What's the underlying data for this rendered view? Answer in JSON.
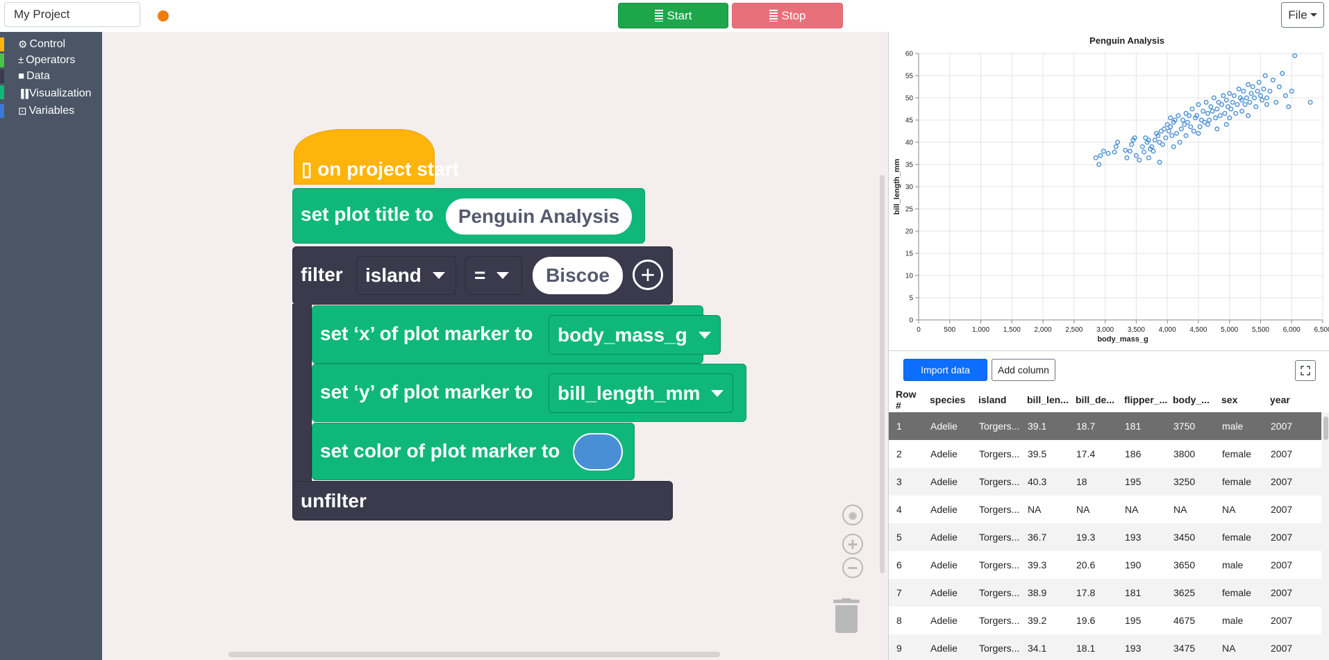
{
  "topbar": {
    "project_name": "My Project",
    "status_color": "#f07c0c",
    "start_label": "Start",
    "stop_label": "Stop",
    "file_label": "File",
    "start_icon": "stack-icon",
    "stop_icon": "stack-icon"
  },
  "toolbox": {
    "categories": [
      {
        "label": "Control",
        "icon": "⚙",
        "color": "#ffb40a"
      },
      {
        "label": "Operators",
        "icon": "±",
        "color": "#4cc24a"
      },
      {
        "label": "Data",
        "icon": "■",
        "color": "#3a3a4c"
      },
      {
        "label": "Visualization",
        "icon": "▐▐",
        "color": "#0fb87a"
      },
      {
        "label": "Variables",
        "icon": "⊡",
        "color": "#3c78d8"
      }
    ]
  },
  "workspace": {
    "hat_block": {
      "icon": "▯",
      "label": "on project start"
    },
    "set_title": {
      "label": "set plot title to",
      "value": "Penguin Analysis"
    },
    "filter": {
      "label": "filter",
      "column": "island",
      "operator": "=",
      "value": "Biscoe"
    },
    "set_x": {
      "label": "set ‘x’ of plot marker to",
      "value": "body_mass_g"
    },
    "set_y": {
      "label": "set ‘y’ of plot marker to",
      "value": "bill_length_mm"
    },
    "set_color": {
      "label": "set color of plot marker to",
      "color": "#4a8fd6"
    },
    "unfilter": {
      "label": "unfilter"
    }
  },
  "data_panel": {
    "import_label": "Import data",
    "add_column_label": "Add column",
    "columns": [
      "Row #",
      "species",
      "island",
      "bill_len...",
      "bill_de...",
      "flipper_...",
      "body_...",
      "sex",
      "year"
    ],
    "rows": [
      [
        "1",
        "Adelie",
        "Torgers...",
        "39.1",
        "18.7",
        "181",
        "3750",
        "male",
        "2007"
      ],
      [
        "2",
        "Adelie",
        "Torgers...",
        "39.5",
        "17.4",
        "186",
        "3800",
        "female",
        "2007"
      ],
      [
        "3",
        "Adelie",
        "Torgers...",
        "40.3",
        "18",
        "195",
        "3250",
        "female",
        "2007"
      ],
      [
        "4",
        "Adelie",
        "Torgers...",
        "NA",
        "NA",
        "NA",
        "NA",
        "NA",
        "2007"
      ],
      [
        "5",
        "Adelie",
        "Torgers...",
        "36.7",
        "19.3",
        "193",
        "3450",
        "female",
        "2007"
      ],
      [
        "6",
        "Adelie",
        "Torgers...",
        "39.3",
        "20.6",
        "190",
        "3650",
        "male",
        "2007"
      ],
      [
        "7",
        "Adelie",
        "Torgers...",
        "38.9",
        "17.8",
        "181",
        "3625",
        "female",
        "2007"
      ],
      [
        "8",
        "Adelie",
        "Torgers...",
        "39.2",
        "19.6",
        "195",
        "4675",
        "male",
        "2007"
      ],
      [
        "9",
        "Adelie",
        "Torgers...",
        "34.1",
        "18.1",
        "193",
        "3475",
        "NA",
        "2007"
      ]
    ],
    "selected_row": 0
  },
  "chart_data": {
    "type": "scatter",
    "title": "Penguin Analysis",
    "xlabel": "body_mass_g",
    "ylabel": "bill_length_mm",
    "xlim": [
      0,
      6500
    ],
    "ylim": [
      0,
      60
    ],
    "xticks": [
      0,
      500,
      1000,
      1500,
      2000,
      2500,
      3000,
      3500,
      4000,
      4500,
      5000,
      5500,
      6000,
      6500
    ],
    "xtick_labels": [
      "0",
      "500",
      "1,000",
      "1,500",
      "2,000",
      "2,500",
      "3,000",
      "3,500",
      "4,000",
      "4,500",
      "5,000",
      "5,500",
      "6,000",
      "6,500"
    ],
    "yticks": [
      0,
      5,
      10,
      15,
      20,
      25,
      30,
      35,
      40,
      45,
      50,
      55,
      60
    ],
    "grid": true,
    "marker_color": "#4a8fd6",
    "points": [
      [
        2850,
        36.5
      ],
      [
        2900,
        35.0
      ],
      [
        2925,
        37.0
      ],
      [
        2975,
        38.0
      ],
      [
        3050,
        37.5
      ],
      [
        3150,
        37.8
      ],
      [
        3175,
        39.0
      ],
      [
        3200,
        40.0
      ],
      [
        3325,
        38.2
      ],
      [
        3400,
        38.0
      ],
      [
        3425,
        39.5
      ],
      [
        3450,
        40.5
      ],
      [
        3475,
        41.0
      ],
      [
        3500,
        37.0
      ],
      [
        3550,
        36.0
      ],
      [
        3600,
        39.0
      ],
      [
        3625,
        37.8
      ],
      [
        3650,
        41.0
      ],
      [
        3675,
        40.0
      ],
      [
        3700,
        36.5
      ],
      [
        3725,
        38.5
      ],
      [
        3750,
        39.0
      ],
      [
        3775,
        38.0
      ],
      [
        3800,
        40.5
      ],
      [
        3825,
        42.0
      ],
      [
        3850,
        41.5
      ],
      [
        3875,
        40.0
      ],
      [
        3900,
        42.5
      ],
      [
        3925,
        39.5
      ],
      [
        3950,
        43.0
      ],
      [
        3975,
        41.0
      ],
      [
        4000,
        44.0
      ],
      [
        4025,
        42.5
      ],
      [
        4050,
        43.5
      ],
      [
        4075,
        41.5
      ],
      [
        4100,
        44.5
      ],
      [
        4125,
        45.0
      ],
      [
        4150,
        42.0
      ],
      [
        4175,
        46.0
      ],
      [
        4200,
        40.0
      ],
      [
        4225,
        43.0
      ],
      [
        4250,
        45.0
      ],
      [
        4275,
        44.0
      ],
      [
        4300,
        46.5
      ],
      [
        4325,
        44.5
      ],
      [
        4350,
        46.0
      ],
      [
        4375,
        43.5
      ],
      [
        4400,
        47.5
      ],
      [
        4425,
        42.5
      ],
      [
        4450,
        45.5
      ],
      [
        4475,
        46.0
      ],
      [
        4500,
        48.5
      ],
      [
        4525,
        43.5
      ],
      [
        4550,
        45.0
      ],
      [
        4575,
        47.0
      ],
      [
        4600,
        44.5
      ],
      [
        4625,
        49.0
      ],
      [
        4650,
        46.5
      ],
      [
        4675,
        45.0
      ],
      [
        4700,
        48.0
      ],
      [
        4725,
        47.0
      ],
      [
        4750,
        50.0
      ],
      [
        4775,
        45.5
      ],
      [
        4800,
        47.5
      ],
      [
        4825,
        49.0
      ],
      [
        4850,
        46.0
      ],
      [
        4875,
        48.5
      ],
      [
        4900,
        50.5
      ],
      [
        4925,
        46.5
      ],
      [
        4950,
        49.5
      ],
      [
        4975,
        48.0
      ],
      [
        5000,
        51.0
      ],
      [
        5025,
        47.5
      ],
      [
        5050,
        49.0
      ],
      [
        5075,
        50.5
      ],
      [
        5100,
        46.5
      ],
      [
        5125,
        48.5
      ],
      [
        5150,
        52.0
      ],
      [
        5175,
        50.0
      ],
      [
        5200,
        49.5
      ],
      [
        5225,
        51.5
      ],
      [
        5250,
        48.5
      ],
      [
        5275,
        50.0
      ],
      [
        5300,
        53.0
      ],
      [
        5325,
        49.0
      ],
      [
        5350,
        51.0
      ],
      [
        5375,
        52.5
      ],
      [
        5400,
        50.0
      ],
      [
        5425,
        48.0
      ],
      [
        5450,
        51.5
      ],
      [
        5475,
        53.5
      ],
      [
        5500,
        50.5
      ],
      [
        5525,
        49.5
      ],
      [
        5550,
        52.0
      ],
      [
        5575,
        55.0
      ],
      [
        5600,
        50.0
      ],
      [
        5650,
        51.5
      ],
      [
        5700,
        54.0
      ],
      [
        5750,
        49.0
      ],
      [
        5800,
        52.5
      ],
      [
        5850,
        55.5
      ],
      [
        5900,
        50.5
      ],
      [
        5950,
        48.0
      ],
      [
        6000,
        51.5
      ],
      [
        6050,
        59.5
      ],
      [
        6300,
        49.0
      ],
      [
        4100,
        39.0
      ],
      [
        4300,
        41.5
      ],
      [
        4650,
        44.0
      ],
      [
        3350,
        36.5
      ],
      [
        3875,
        35.5
      ],
      [
        4500,
        42.0
      ],
      [
        5000,
        45.5
      ],
      [
        5200,
        47.0
      ],
      [
        5600,
        48.5
      ],
      [
        4800,
        43.0
      ],
      [
        3700,
        40.5
      ],
      [
        4050,
        45.5
      ],
      [
        4950,
        44.0
      ],
      [
        5300,
        46.0
      ]
    ]
  }
}
